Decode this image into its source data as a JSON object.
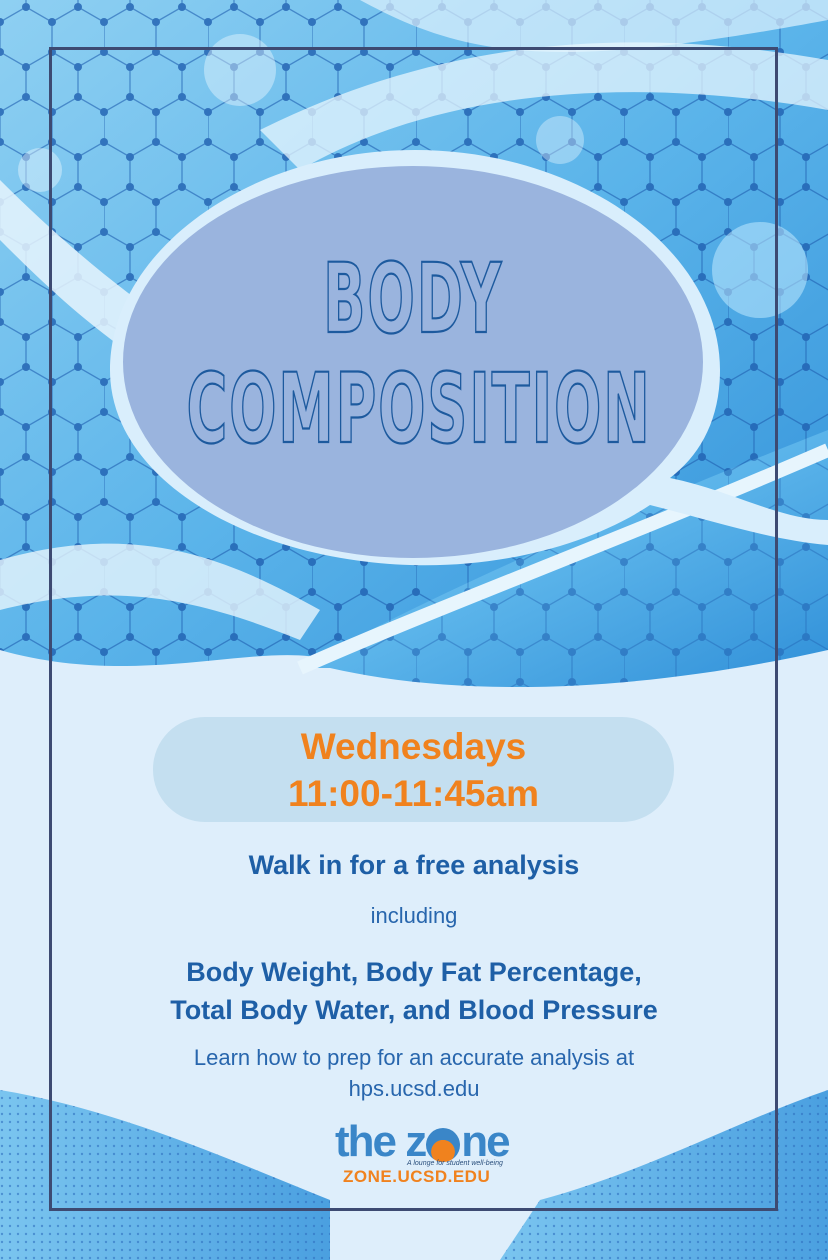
{
  "title": {
    "line1": "BODY",
    "line2": "COMPOSITION"
  },
  "schedule": {
    "day": "Wednesdays",
    "time": "11:00-11:45am"
  },
  "details": {
    "walk_in": "Walk in for a free analysis",
    "including": "including",
    "metrics_line1": "Body Weight, Body Fat Percentage,",
    "metrics_line2": "Total Body Water, and Blood Pressure",
    "learn_line1": "Learn how to prep for an accurate analysis at",
    "learn_line2": "hps.ucsd.edu"
  },
  "logo": {
    "word_before": "the z",
    "word_after": "ne",
    "tagline": "A lounge for student well-being",
    "url": "ZONE.UCSD.EDU"
  },
  "colors": {
    "accent_orange": "#f0821e",
    "text_blue": "#1e5fa6",
    "frame": "#3d4a72",
    "pill": "#c4dff0",
    "bubble": "#9ab4de"
  }
}
